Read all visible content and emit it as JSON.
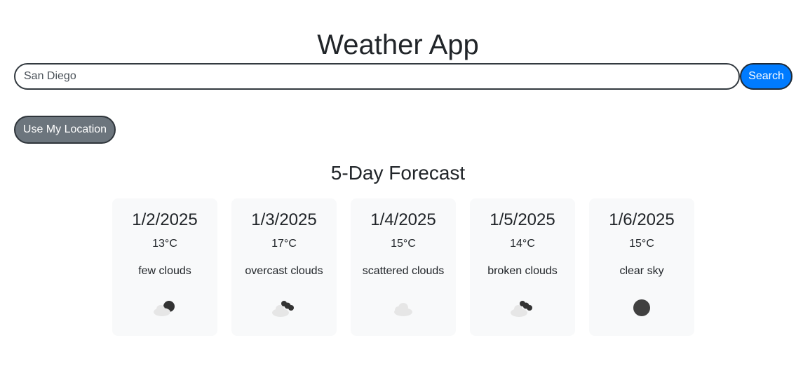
{
  "app": {
    "title": "Weather App"
  },
  "search": {
    "value": "San Diego",
    "button_label": "Search"
  },
  "location_button": {
    "label": "Use My Location"
  },
  "forecast": {
    "heading": "5-Day Forecast",
    "days": [
      {
        "date": "1/2/2025",
        "temp": "13°C",
        "description": "few clouds",
        "icon": "few-clouds-icon"
      },
      {
        "date": "1/3/2025",
        "temp": "17°C",
        "description": "overcast clouds",
        "icon": "overcast-clouds-icon"
      },
      {
        "date": "1/4/2025",
        "temp": "15°C",
        "description": "scattered clouds",
        "icon": "scattered-clouds-icon"
      },
      {
        "date": "1/5/2025",
        "temp": "14°C",
        "description": "broken clouds",
        "icon": "broken-clouds-icon"
      },
      {
        "date": "1/6/2025",
        "temp": "15°C",
        "description": "clear sky",
        "icon": "clear-sky-icon"
      }
    ]
  },
  "colors": {
    "search_button": "#007bff",
    "location_button": "#6c757d",
    "card_background": "#f8f9fa",
    "icon_dark": "#333333",
    "icon_light": "#e6e6e6"
  }
}
